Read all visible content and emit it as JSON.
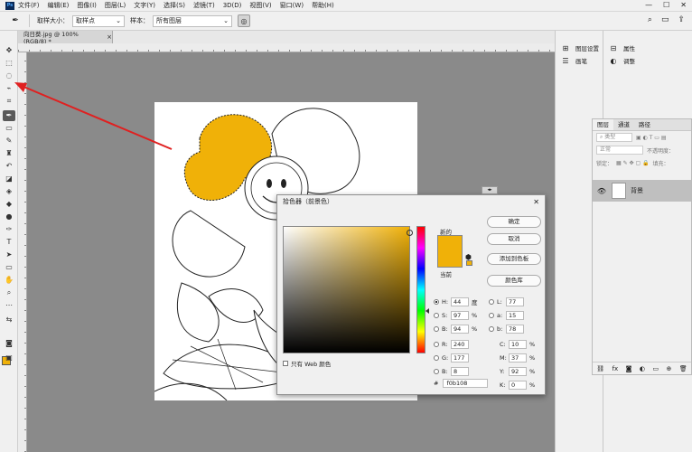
{
  "menu": {
    "logo": "Ps",
    "items": [
      "文件(F)",
      "编辑(E)",
      "图像(I)",
      "图层(L)",
      "文字(Y)",
      "选择(S)",
      "滤镜(T)",
      "3D(D)",
      "视图(V)",
      "窗口(W)",
      "帮助(H)"
    ],
    "controls": [
      "—",
      "☐",
      "✕"
    ]
  },
  "options": {
    "sample_size_label": "取样大小：",
    "sample_size_value": "取样点",
    "sample_label": "样本：",
    "sample_value": "所有图层"
  },
  "document": {
    "tab_title": "向日葵.jpg @ 100%(RGB/8) *",
    "close": "×"
  },
  "right_panels": {
    "items_col1": [
      "图层设置",
      "画笔"
    ],
    "items_col2": [
      "属性",
      "调整"
    ]
  },
  "layers_panel": {
    "tabs": [
      "图层",
      "通道",
      "路径"
    ],
    "kind_label": "类型",
    "blend_mode": "正常",
    "opacity_label": "不透明度：",
    "lock_label": "锁定：",
    "fill_label": "填充：",
    "layer_name": "背景"
  },
  "color_picker": {
    "title": "拾色器（前景色）",
    "new_label": "新的",
    "current_label": "当前",
    "ok_label": "确定",
    "cancel_label": "取消",
    "add_swatch_label": "添加到色板",
    "color_libs_label": "颜色库",
    "web_only_label": "只有 Web 颜色",
    "color": "#f0b108",
    "fields": {
      "H": "44",
      "S": "97",
      "B": "94",
      "R": "240",
      "G": "177",
      "B2": "8",
      "L": "77",
      "a": "15",
      "b": "78",
      "C": "10",
      "M": "37",
      "Y": "92",
      "K": "0"
    },
    "units": {
      "degree": "度",
      "percent": "%"
    },
    "hex": "f0b108"
  }
}
